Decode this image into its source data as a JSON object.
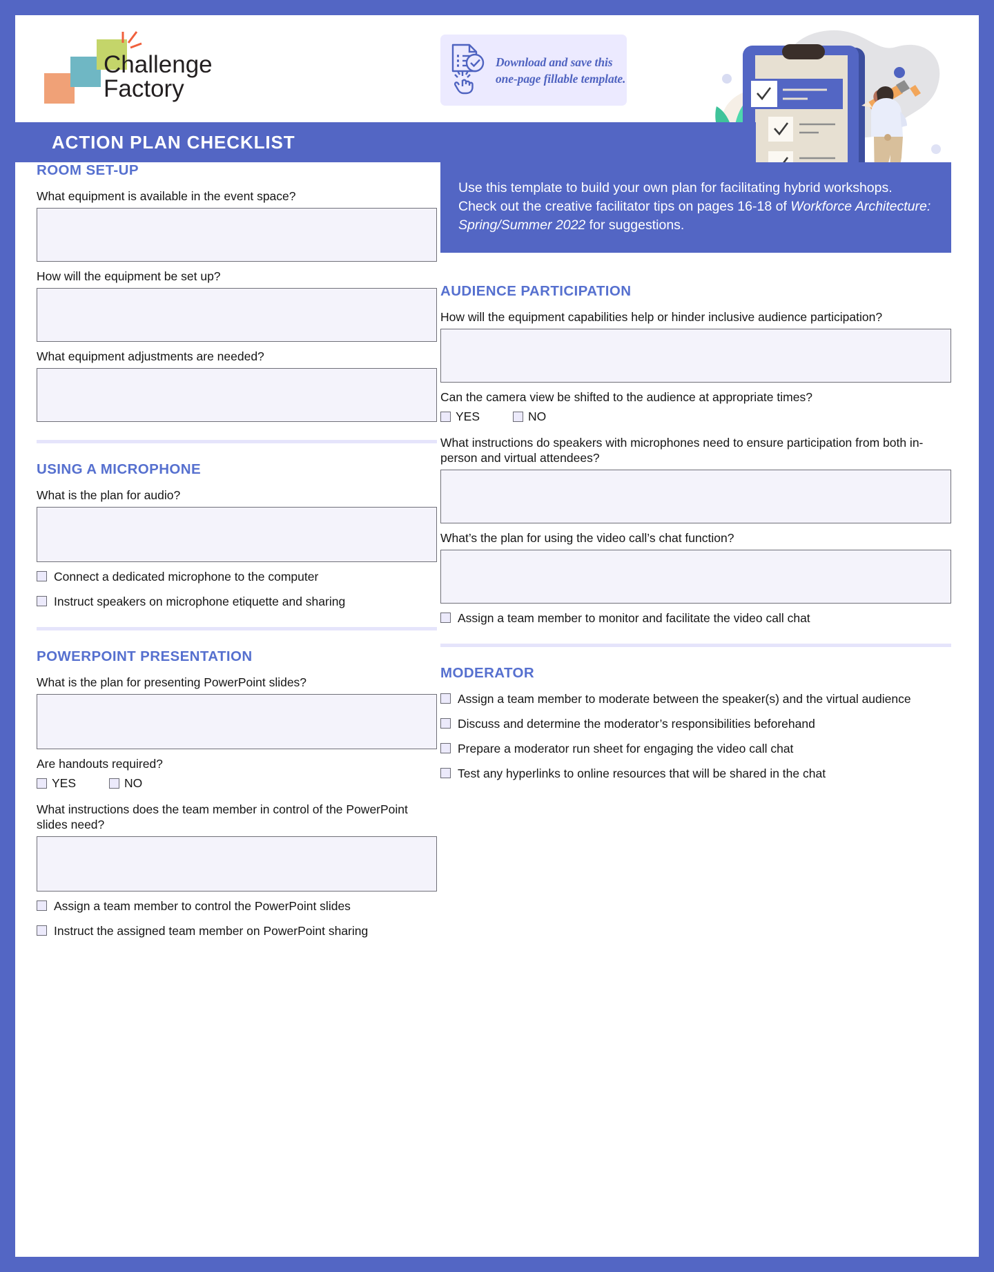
{
  "brand": {
    "logo_line1": "Challenge",
    "logo_line2": "Factory"
  },
  "download_banner": {
    "icon": "document-check-click-icon",
    "text": "Download and save this one-page fillable template."
  },
  "title_bar": {
    "title": "ACTION PLAN CHECKLIST"
  },
  "callout": {
    "text_before": "Use this template to build your own plan for facilitating hybrid workshops. Check out the creative facilitator tips on pages 16-18 of ",
    "italic_text": "Workforce Architecture: Spring/Summer 2022",
    "text_after": " for suggestions."
  },
  "left_column": {
    "sections": [
      {
        "id": "room-set-up",
        "title": "ROOM SET-UP",
        "questions": [
          "What equipment is available in the event space?",
          "How will the equipment be set up?",
          "What equipment adjustments are needed?"
        ]
      },
      {
        "id": "using-a-microphone",
        "title": "USING A MICROPHONE",
        "question": "What is the plan for audio?",
        "checkboxes": [
          "Connect a dedicated microphone to the computer",
          "Instruct speakers on microphone etiquette and sharing"
        ]
      },
      {
        "id": "powerpoint-presentation",
        "title": "POWERPOINT PRESENTATION",
        "question1": "What is the plan for presenting PowerPoint slides?",
        "question2": "Are handouts required?",
        "yes_label": "YES",
        "no_label": "NO",
        "question3": "What instructions does the team member in control of the PowerPoint slides need?",
        "checkboxes": [
          "Assign a team member to control the PowerPoint slides",
          "Instruct the assigned team member on PowerPoint sharing"
        ]
      }
    ]
  },
  "right_column": {
    "audience": {
      "id": "audience-participation",
      "title": "AUDIENCE PARTICIPATION",
      "question1": "How will the equipment capabilities help or hinder inclusive audience participation?",
      "question2": "Can the camera view be shifted to the audience at appropriate times?",
      "yes_label": "YES",
      "no_label": "NO",
      "question3": "What instructions do speakers with microphones need to ensure participation from both in-person and virtual attendees?",
      "question4": "What’s the plan for using the video call’s chat function?",
      "checkbox1": "Assign a team member to monitor and facilitate the video call chat"
    },
    "moderator": {
      "id": "moderator",
      "title": "MODERATOR",
      "checkboxes": [
        "Assign a team member to moderate between the speaker(s) and the virtual audience",
        "Discuss and determine the moderator’s responsibilities beforehand",
        "Prepare a moderator run sheet for engaging the video call chat",
        "Test any hyperlinks to online resources that will be shared in the chat"
      ]
    }
  },
  "colors": {
    "brand_blue": "#5366c4",
    "heading_blue": "#5670cf",
    "field_fill": "#f4f3fb",
    "divider": "#e5e4fb",
    "banner_bg": "#eceaff"
  }
}
